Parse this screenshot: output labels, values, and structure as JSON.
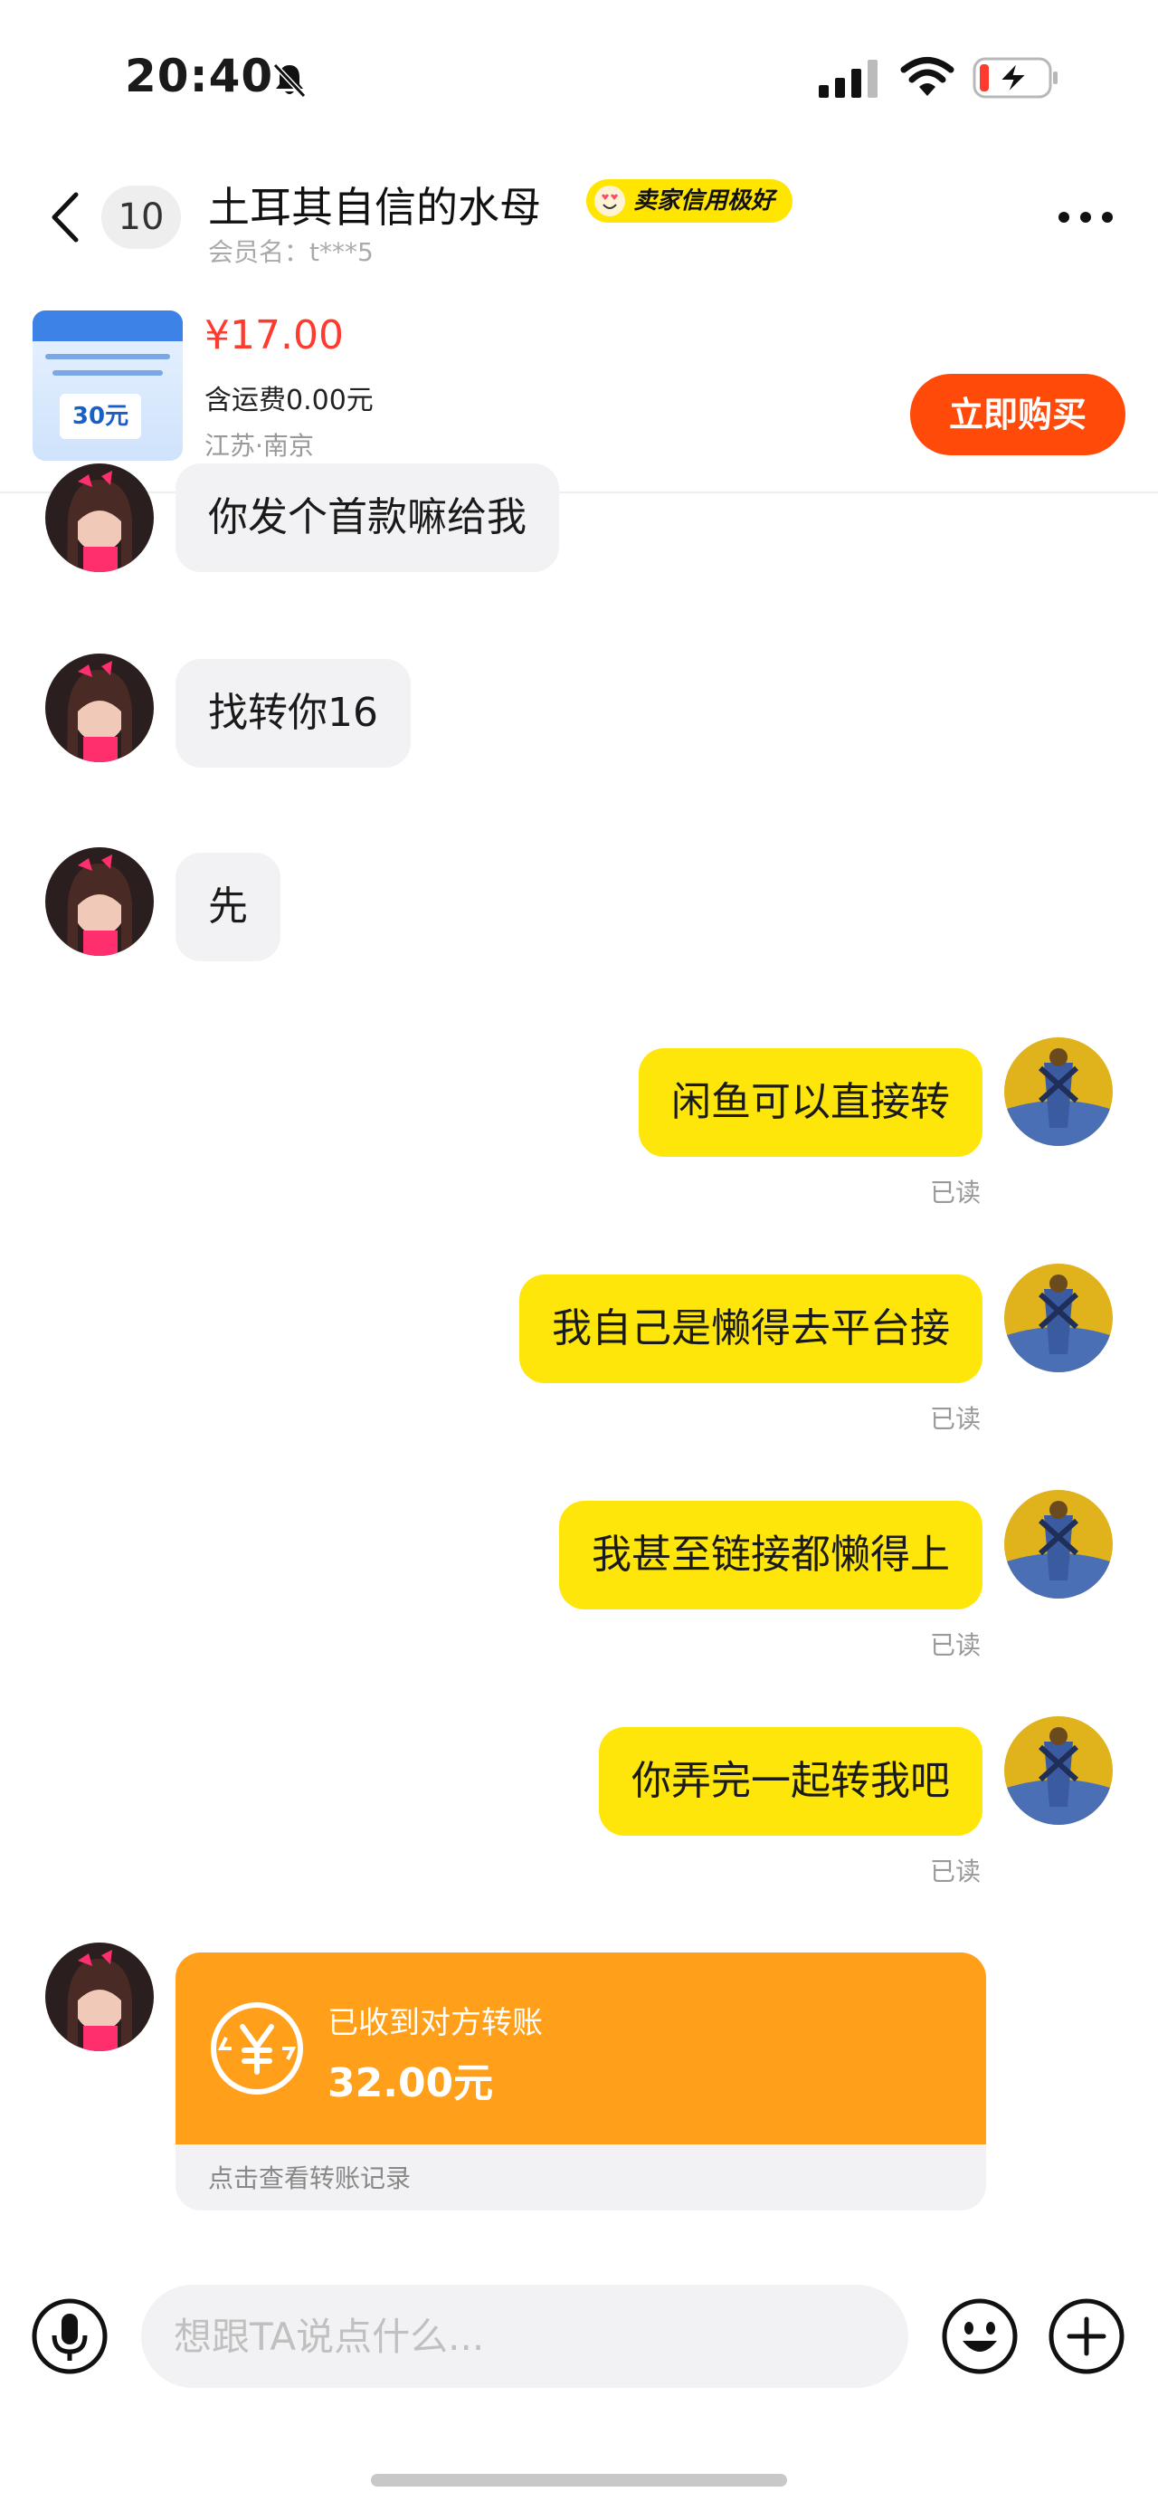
{
  "status_bar": {
    "time": "20:40"
  },
  "header": {
    "unread_count": "10",
    "title": "土耳其自信的水母",
    "credit_badge": "卖家信用极好",
    "member_label": "会员名：t***5"
  },
  "product": {
    "price": "¥17.00",
    "shipping": "含运费0.00元",
    "location": "江苏·南京",
    "buy_label": "立即购买",
    "thumb_price": "30元"
  },
  "messages": [
    {
      "side": "left",
      "text": "你发个首款嘛给我"
    },
    {
      "side": "left",
      "text": "找转你16"
    },
    {
      "side": "left",
      "text": "先"
    },
    {
      "side": "right",
      "text": "闲鱼可以直接转",
      "status": "已读"
    },
    {
      "side": "right",
      "text": "我自己是懒得去平台接",
      "status": "已读"
    },
    {
      "side": "right",
      "text": "我甚至链接都懒得上",
      "status": "已读"
    },
    {
      "side": "right",
      "text": "你弄完一起转我吧",
      "status": "已读"
    }
  ],
  "transfer": {
    "title": "已收到对方转账",
    "amount": "32.00元",
    "link": "点击查看转账记录"
  },
  "input": {
    "placeholder": "想跟TA说点什么..."
  },
  "colors": {
    "accent_yellow": "#ffe60a",
    "buy_orange": "#ff4a0a",
    "transfer_orange": "#ff9f1a",
    "price_red": "#ff3b30"
  }
}
